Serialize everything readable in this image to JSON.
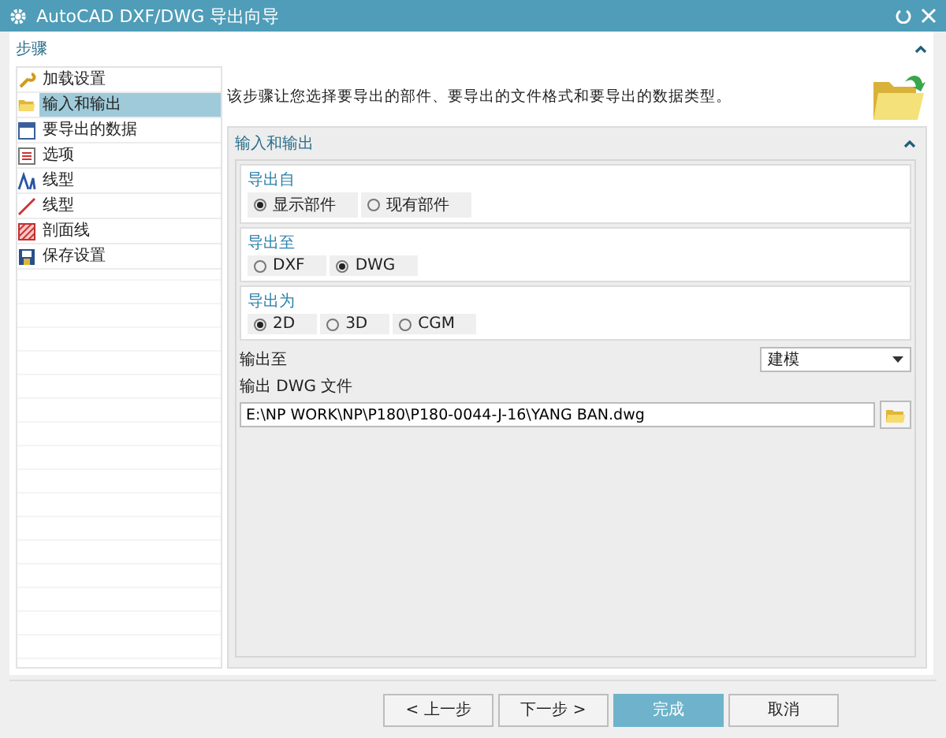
{
  "window": {
    "title": "AutoCAD DXF/DWG 导出向导"
  },
  "steps_header": {
    "label": "步骤",
    "expanded": true
  },
  "steps": [
    {
      "label": "加载设置",
      "selected": false
    },
    {
      "label": "输入和输出",
      "selected": true
    },
    {
      "label": "要导出的数据",
      "selected": false
    },
    {
      "label": "选项",
      "selected": false
    },
    {
      "label": "线型",
      "selected": false
    },
    {
      "label": "线型",
      "selected": false
    },
    {
      "label": "剖面线",
      "selected": false
    },
    {
      "label": "保存设置",
      "selected": false
    }
  ],
  "description": "该步骤让您选择要导出的部件、要导出的文件格式和要导出的数据类型。",
  "section": {
    "title": "输入和输出",
    "expanded": true,
    "groups": [
      {
        "title": "导出自",
        "options": [
          {
            "label": "显示部件",
            "selected": true
          },
          {
            "label": "现有部件",
            "selected": false
          }
        ]
      },
      {
        "title": "导出至",
        "options": [
          {
            "label": "DXF",
            "selected": false
          },
          {
            "label": "DWG",
            "selected": true
          }
        ]
      },
      {
        "title": "导出为",
        "options": [
          {
            "label": "2D",
            "selected": true
          },
          {
            "label": "3D",
            "selected": false
          },
          {
            "label": "CGM",
            "selected": false
          }
        ]
      }
    ],
    "output_to": {
      "label": "输出至",
      "value": "建模"
    },
    "output_file": {
      "label": "输出 DWG 文件",
      "value": "E:\\NP WORK\\NP\\P180\\P180-0044-J-16\\YANG BAN.dwg"
    }
  },
  "buttons": [
    {
      "label": "< 上一步",
      "primary": false
    },
    {
      "label": "下一步 >",
      "primary": false
    },
    {
      "label": "完成",
      "primary": true
    },
    {
      "label": "取消",
      "primary": false
    }
  ]
}
